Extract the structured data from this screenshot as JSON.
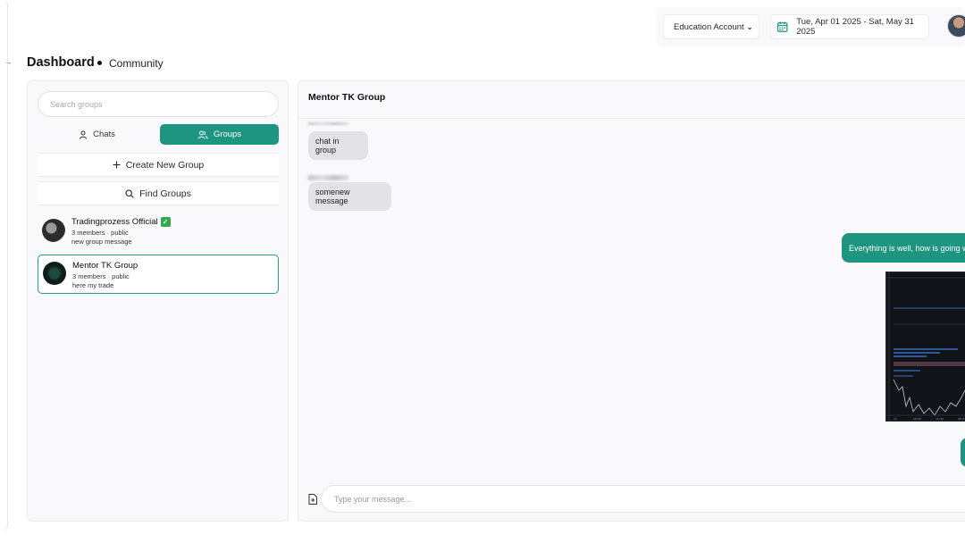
{
  "header": {
    "account_select": "Education Account",
    "date_range": "Tue, Apr 01 2025 - Sat, May 31 2025"
  },
  "page": {
    "title": "Dashboard",
    "breadcrumb": "Community"
  },
  "left_panel": {
    "search_placeholder": "Search groups",
    "tabs": [
      {
        "label": "Chats",
        "active": false
      },
      {
        "label": "Groups",
        "active": true
      }
    ],
    "create_group_label": "Create New Group",
    "find_groups_label": "Find Groups",
    "groups": [
      {
        "name": "Tradingprozess Official",
        "verified": true,
        "meta": "3 members · public",
        "last_message": "new group message",
        "selected": false
      },
      {
        "name": "Mentor TK Group",
        "verified": false,
        "meta": "3 members · public",
        "last_message": "here my trade",
        "selected": true
      }
    ]
  },
  "chat": {
    "title": "Mentor TK Group",
    "messages": [
      {
        "direction": "in",
        "text": "chat in group"
      },
      {
        "direction": "in",
        "text": "somenew message"
      },
      {
        "direction": "out",
        "text": "Everything is well, how is going w"
      },
      {
        "direction": "out",
        "type": "image",
        "icon": "chart-screenshot"
      }
    ],
    "input_placeholder": "Type your message..."
  },
  "colors": {
    "accent": "#1e9580",
    "panel_bg": "#f9f8fb",
    "incoming_bubble": "#e3e3e7"
  }
}
